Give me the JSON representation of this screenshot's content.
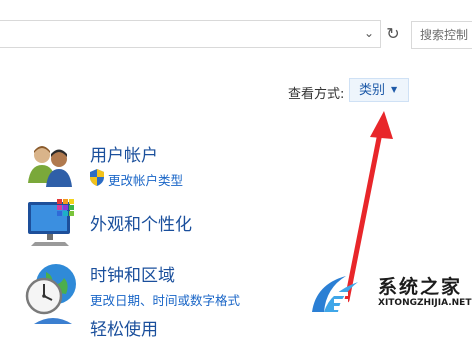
{
  "address_bar": {
    "chevron_icon": "chevron-down-icon",
    "refresh_icon": "refresh-icon"
  },
  "search": {
    "placeholder": "搜索控制"
  },
  "view": {
    "label": "查看方式:",
    "selected": "类别"
  },
  "categories": [
    {
      "title": "用户帐户",
      "link": "更改帐户类型",
      "icon": "users-icon",
      "link_icon": "uac-shield-icon"
    },
    {
      "title": "外观和个性化",
      "icon": "monitor-palette-icon"
    },
    {
      "title": "时钟和区域",
      "link": "更改日期、时间或数字格式",
      "icon": "clock-globe-icon"
    },
    {
      "title": "轻松使用",
      "icon": "ease-of-access-icon"
    }
  ],
  "watermark": {
    "name": "系统之家",
    "domain": "XITONGZHIJIA.NET"
  },
  "colors": {
    "link": "#1a66c7",
    "title": "#1a4f9c",
    "arrow": "#e8262a"
  }
}
